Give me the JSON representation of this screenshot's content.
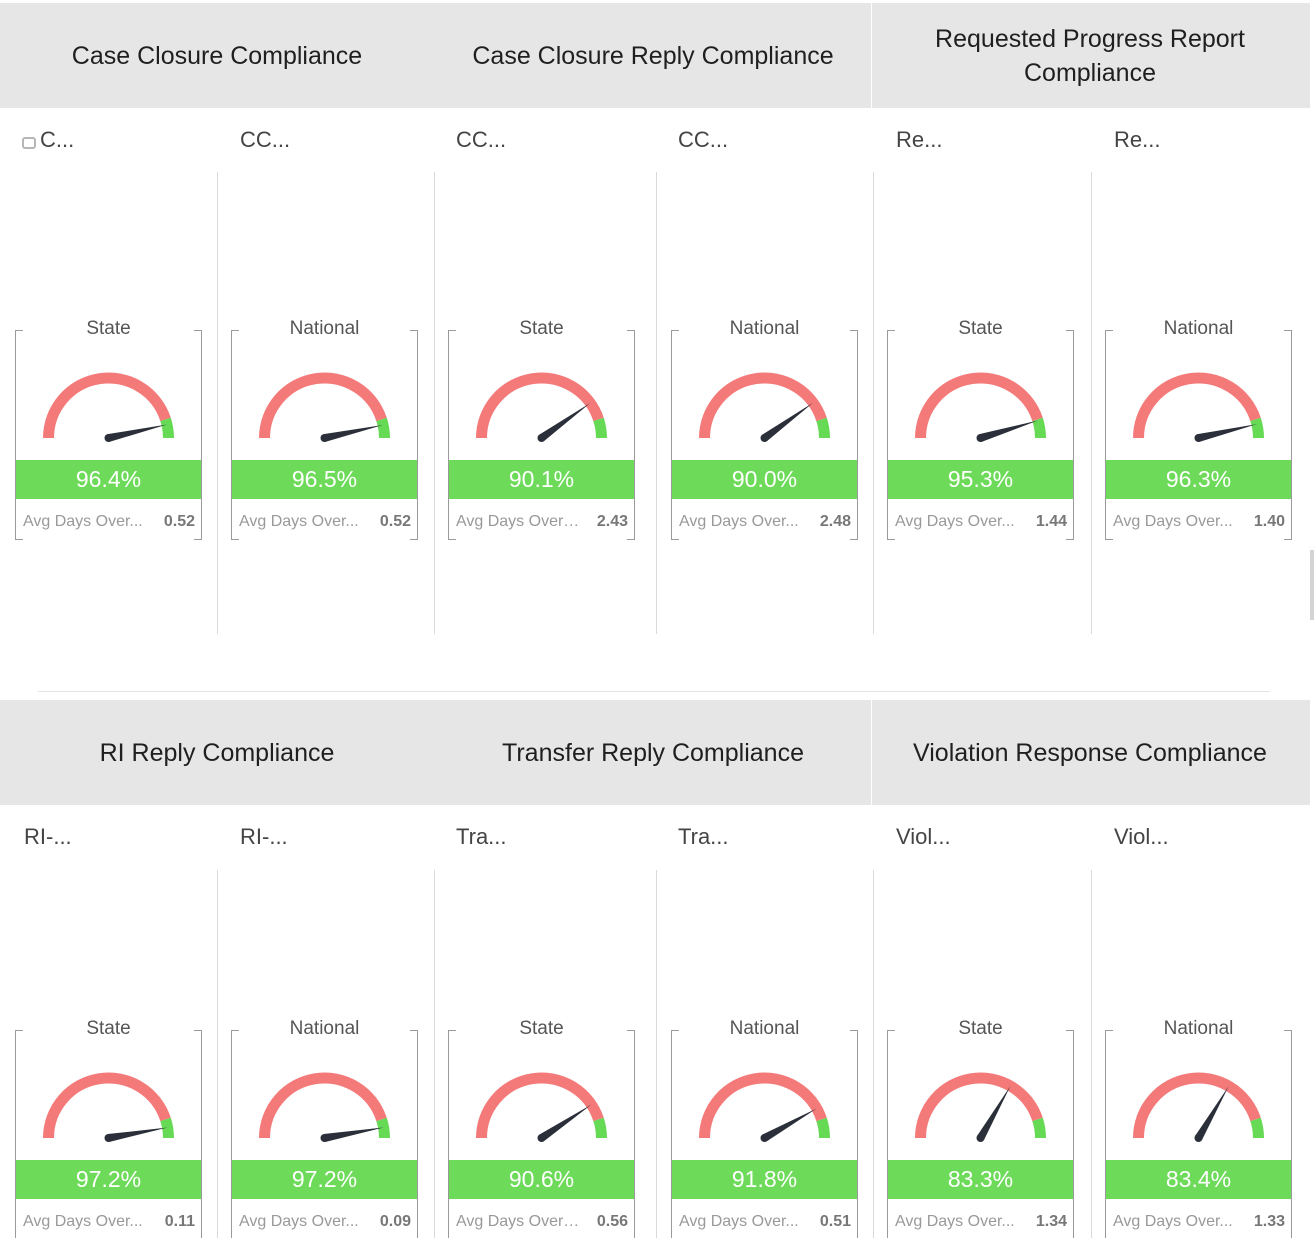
{
  "sections": [
    {
      "headers": [
        "Case Closure Compliance",
        "Case Closure Reply Compliance",
        "Requested Progress Report Compliance"
      ],
      "columns": [
        {
          "title": "C...",
          "scope": "State",
          "value": "96.4%",
          "pct": 96.4,
          "footer_label": "Avg Days Over...",
          "footer_value": "0.52"
        },
        {
          "title": "CC...",
          "scope": "National",
          "value": "96.5%",
          "pct": 96.5,
          "footer_label": "Avg Days Over...",
          "footer_value": "0.52"
        },
        {
          "title": "CC...",
          "scope": "State",
          "value": "90.1%",
          "pct": 90.1,
          "footer_label": "Avg Days Overd...",
          "footer_value": "2.43"
        },
        {
          "title": "CC...",
          "scope": "National",
          "value": "90.0%",
          "pct": 90.0,
          "footer_label": "Avg Days Over...",
          "footer_value": "2.48"
        },
        {
          "title": "Re...",
          "scope": "State",
          "value": "95.3%",
          "pct": 95.3,
          "footer_label": "Avg Days Over...",
          "footer_value": "1.44"
        },
        {
          "title": "Re...",
          "scope": "National",
          "value": "96.3%",
          "pct": 96.3,
          "footer_label": "Avg Days Over...",
          "footer_value": "1.40"
        }
      ]
    },
    {
      "headers": [
        "RI Reply Compliance",
        "Transfer Reply Compliance",
        "Violation Response Compliance"
      ],
      "columns": [
        {
          "title": "RI-...",
          "scope": "State",
          "value": "97.2%",
          "pct": 97.2,
          "footer_label": "Avg Days Over...",
          "footer_value": "0.11"
        },
        {
          "title": "RI-...",
          "scope": "National",
          "value": "97.2%",
          "pct": 97.2,
          "footer_label": "Avg Days Over...",
          "footer_value": "0.09"
        },
        {
          "title": "Tra...",
          "scope": "State",
          "value": "90.6%",
          "pct": 90.6,
          "footer_label": "Avg Days Overd...",
          "footer_value": "0.56"
        },
        {
          "title": "Tra...",
          "scope": "National",
          "value": "91.8%",
          "pct": 91.8,
          "footer_label": "Avg Days Over...",
          "footer_value": "0.51"
        },
        {
          "title": "Viol...",
          "scope": "State",
          "value": "83.3%",
          "pct": 83.3,
          "footer_label": "Avg Days Over...",
          "footer_value": "1.34"
        },
        {
          "title": "Viol...",
          "scope": "National",
          "value": "83.4%",
          "pct": 83.4,
          "footer_label": "Avg Days Over...",
          "footer_value": "1.33"
        }
      ]
    }
  ],
  "colors": {
    "red_band": "#f47a7a",
    "green_band": "#66d955",
    "needle": "#2b2f3a",
    "value_bar": "#6ddb59"
  },
  "icons": {
    "first_title_icon": "external-link-icon"
  }
}
